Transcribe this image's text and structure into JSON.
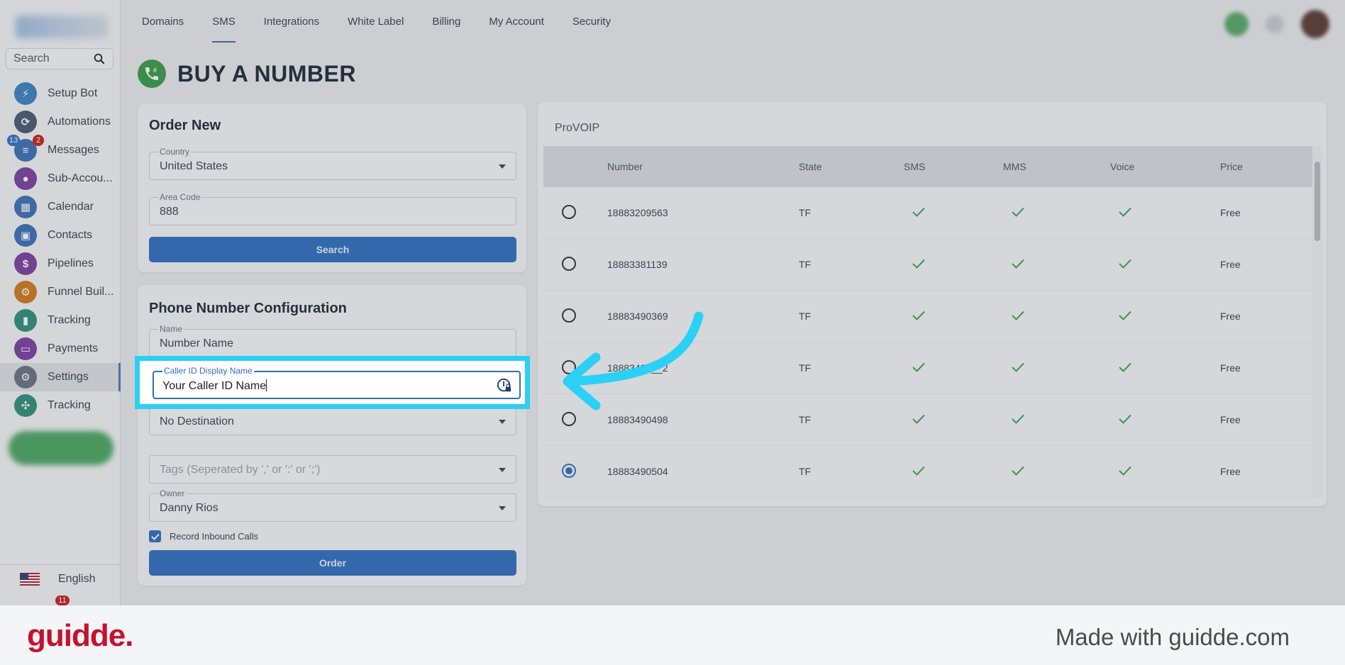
{
  "sidebar": {
    "search_placeholder": "Search",
    "items": [
      {
        "label": "Setup Bot",
        "icon": "bolt-icon",
        "color": "#3b82c4"
      },
      {
        "label": "Automations",
        "icon": "automation-icon",
        "color": "#4a5a72"
      },
      {
        "label": "Messages",
        "icon": "chat-icon",
        "color": "#3b6fb6",
        "badge_blue": "13",
        "badge_red": "2"
      },
      {
        "label": "Sub-Accou...",
        "icon": "user-icon",
        "color": "#7b3fa0"
      },
      {
        "label": "Calendar",
        "icon": "calendar-icon",
        "color": "#3b6fb6"
      },
      {
        "label": "Contacts",
        "icon": "contacts-icon",
        "color": "#3b6fb6"
      },
      {
        "label": "Pipelines",
        "icon": "dollar-icon",
        "color": "#7b3fa0"
      },
      {
        "label": "Funnel Buil...",
        "icon": "funnel-icon",
        "color": "#d07a1c"
      },
      {
        "label": "Tracking",
        "icon": "chart-icon",
        "color": "#2f8f7a"
      },
      {
        "label": "Payments",
        "icon": "card-icon",
        "color": "#7b3fa0"
      },
      {
        "label": "Settings",
        "icon": "gear-icon",
        "color": "#6b7280"
      },
      {
        "label": "Tracking",
        "icon": "network-icon",
        "color": "#2f8f7a"
      }
    ],
    "language": "English",
    "bottom_badge": "11"
  },
  "topnav": {
    "tabs": [
      "Domains",
      "SMS",
      "Integrations",
      "White Label",
      "Billing",
      "My Account",
      "Security"
    ],
    "active": "SMS"
  },
  "page": {
    "title": "BUY A NUMBER"
  },
  "order_new": {
    "title": "Order New",
    "country_label": "Country",
    "country_value": "United States",
    "area_code_label": "Area Code",
    "area_code_value": "888",
    "search_button": "Search"
  },
  "config": {
    "title": "Phone Number Configuration",
    "name_label": "Name",
    "name_placeholder": "Number Name",
    "caller_id_label": "Caller ID Display Name",
    "caller_id_value": "Your Caller ID Name",
    "destination_value": "No Destination",
    "tags_placeholder": "Tags (Seperated by ',' or ':' or ';')",
    "owner_label": "Owner",
    "owner_value": "Danny Rios",
    "record_label": "Record Inbound Calls",
    "record_checked": true,
    "order_button": "Order"
  },
  "numbers_table": {
    "provider": "ProVOIP",
    "headers": [
      "Number",
      "State",
      "SMS",
      "MMS",
      "Voice",
      "Price"
    ],
    "rows": [
      {
        "number": "18883209563",
        "state": "TF",
        "price": "Free",
        "selected": false
      },
      {
        "number": "18883381139",
        "state": "TF",
        "price": "Free",
        "selected": false
      },
      {
        "number": "18883490369",
        "state": "TF",
        "price": "Free",
        "selected": false
      },
      {
        "number": "18883490__2",
        "state": "TF",
        "price": "Free",
        "selected": false
      },
      {
        "number": "18883490498",
        "state": "TF",
        "price": "Free",
        "selected": false
      },
      {
        "number": "18883490504",
        "state": "TF",
        "price": "Free",
        "selected": true
      }
    ]
  },
  "colors": {
    "accent": "#2f6fc0",
    "highlight": "#2ad0f5",
    "check": "#3aa655",
    "brand": "#c8102e"
  },
  "footer": {
    "brand": "guidde.",
    "made_with": "Made with guidde.com"
  }
}
